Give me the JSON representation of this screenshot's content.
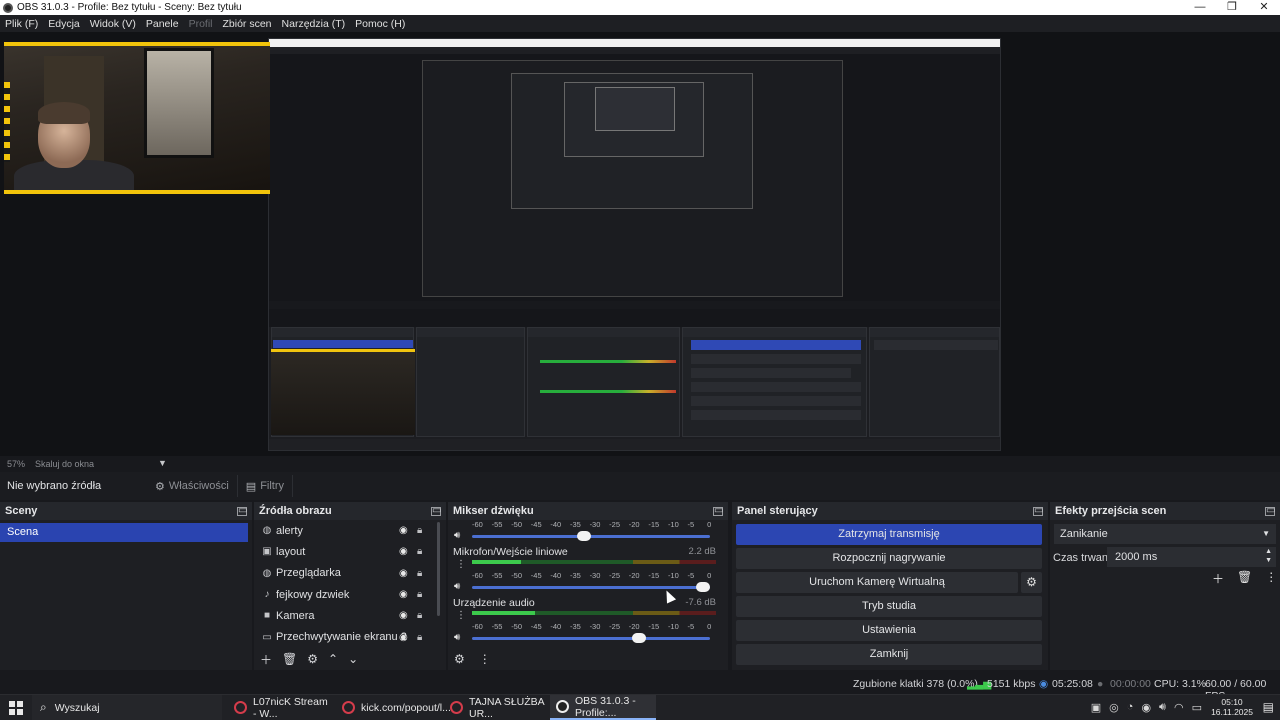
{
  "window": {
    "title": "OBS 31.0.3 - Profile: Bez tytułu - Sceny: Bez tytułu",
    "minimize": "—",
    "restore": "❐",
    "close": "✕"
  },
  "menu": [
    "Plik (F)",
    "Edycja",
    "Widok (V)",
    "Panele",
    "Profil",
    "Zbiór scen",
    "Narzędzia (T)",
    "Pomoc (H)"
  ],
  "preview": {
    "zoom": "57%",
    "fit_label": "Skaluj do okna"
  },
  "source_toolbar": {
    "no_source": "Nie wybrano źródła",
    "properties": "Właściwości",
    "filters": "Filtry"
  },
  "scenes": {
    "title": "Sceny",
    "items": [
      "Scena"
    ]
  },
  "sources": {
    "title": "Źródła obrazu",
    "items": [
      {
        "name": "alerty",
        "icon": "globe-icon"
      },
      {
        "name": "layout",
        "icon": "image-icon"
      },
      {
        "name": "Przeglądarka",
        "icon": "globe-icon"
      },
      {
        "name": "fejkowy dzwiek",
        "icon": "speaker-icon"
      },
      {
        "name": "Kamera",
        "icon": "camera-icon"
      },
      {
        "name": "Przechwytywanie ekranu 2",
        "icon": "monitor-icon"
      }
    ]
  },
  "mixer": {
    "title": "Mikser dźwięku",
    "scale": [
      "-60",
      "-55",
      "-50",
      "-45",
      "-40",
      "-35",
      "-30",
      "-25",
      "-20",
      "-15",
      "-10",
      "-5",
      "0"
    ],
    "channels": [
      {
        "name": "Mikrofon/Wejście liniowe",
        "db": "2.2 dB",
        "level": 0.2,
        "volume": 0.97
      },
      {
        "name": "Urządzenie audio",
        "db": "-7.6 dB",
        "level": 0.26,
        "volume": 0.7
      }
    ],
    "top_volume": 0.47
  },
  "controls": {
    "title": "Panel sterujący",
    "stop_stream": "Zatrzymaj transmisję",
    "start_record": "Rozpocznij nagrywanie",
    "virtual_cam": "Uruchom Kamerę Wirtualną",
    "studio_mode": "Tryb studia",
    "settings": "Ustawienia",
    "exit": "Zamknij"
  },
  "transitions": {
    "title": "Efekty przejścia scen",
    "selected": "Zanikanie",
    "duration_label": "Czas trwania",
    "duration": "2000 ms"
  },
  "status": {
    "dropped": "Zgubione klatki 378 (0.0%)",
    "bitrate": "5151 kbps",
    "stream_time": "05:25:08",
    "rec_time": "00:00:00",
    "cpu": "CPU: 3.1%",
    "fps": "60.00 / 60.00 FPS"
  },
  "taskbar": {
    "search": "Wyszukaj",
    "tasks": [
      {
        "label": "L07nicK Stream - W...",
        "icon": "opera-icon"
      },
      {
        "label": "kick.com/popout/l...",
        "icon": "opera-icon"
      },
      {
        "label": "TAJNA SŁUŻBA UR...",
        "icon": "opera-icon"
      },
      {
        "label": "OBS 31.0.3 - Profile:...",
        "icon": "obs-icon"
      }
    ],
    "time": "05:10",
    "date": "16.11.2025"
  },
  "colors": {
    "accent": "#2c46b2",
    "meter_green": "#3cc94c",
    "highlight": "#f2c40b"
  }
}
